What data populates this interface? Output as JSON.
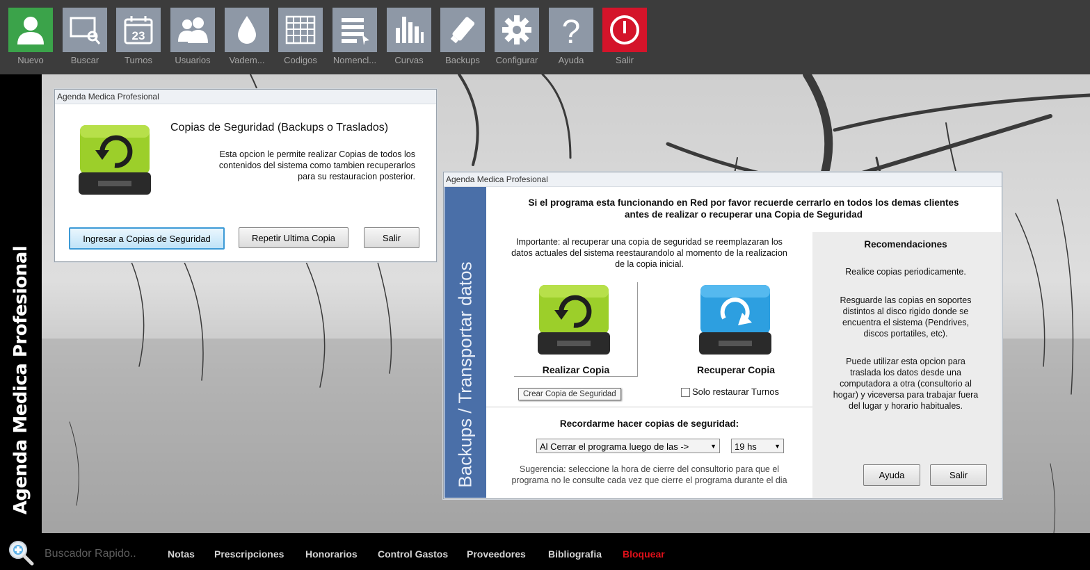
{
  "toolbar": {
    "buttons": [
      {
        "label": "Nuevo",
        "icon": "user-icon",
        "color": "#3ba34a"
      },
      {
        "label": "Buscar",
        "icon": "search-screen-icon"
      },
      {
        "label": "Turnos",
        "icon": "calendar-icon",
        "day": "23"
      },
      {
        "label": "Usuarios",
        "icon": "users-icon"
      },
      {
        "label": "Vadem...",
        "icon": "drop-icon"
      },
      {
        "label": "Codigos",
        "icon": "grid-icon"
      },
      {
        "label": "Nomencl...",
        "icon": "list-icon"
      },
      {
        "label": "Curvas",
        "icon": "bar-chart-icon"
      },
      {
        "label": "Backups",
        "icon": "usb-drive-icon"
      },
      {
        "label": "Configurar",
        "icon": "gear-icon"
      },
      {
        "label": "Ayuda",
        "icon": "question-icon"
      },
      {
        "label": "Salir",
        "icon": "power-icon",
        "color": "#d4142a"
      }
    ]
  },
  "sidebar": {
    "title": "Agenda Medica Profesional"
  },
  "dialog1": {
    "title": "Agenda Medica Profesional",
    "heading": "Copias de Seguridad (Backups o Traslados)",
    "desc_lines": [
      "Esta opcion le permite realizar Copias de todos los",
      "contenidos del sistema como tambien recuperarlos",
      "para su restauracion posterior."
    ],
    "btn_enter": "Ingresar a Copias de Seguridad",
    "btn_repeat": "Repetir Ultima Copia",
    "btn_exit": "Salir"
  },
  "dialog2": {
    "title": "Agenda Medica Profesional",
    "side_banner": "Backups / Transportar datos",
    "warning_lines": [
      "Si el programa esta funcionando en Red por favor recuerde cerrarlo en todos los demas clientes",
      "antes de realizar o recuperar una Copia de Seguridad"
    ],
    "important_lines": [
      "Importante: al recuperar una copia de seguridad se reemplazaran los",
      "datos actuales del sistema reestaurandolo al momento de la realizacion",
      "de la copia inicial."
    ],
    "make_copy": "Realizar Copia",
    "tooltip": "Crear Copia de Seguridad",
    "restore_copy": "Recuperar Copia",
    "only_turns": "Solo restaurar Turnos",
    "reminder_label": "Recordarme hacer copias de seguridad:",
    "reminder_select": "Al Cerrar el programa luego de las ->",
    "hour_select": "19 hs",
    "suggestion_lines": [
      "Sugerencia: seleccione la hora de cierre del consultorio para que el",
      "programa no le consulte cada vez que cierre el programa durante el dia"
    ],
    "reco_title": "Recomendaciones",
    "reco_1": "Realice copias periodicamente.",
    "reco_2_lines": [
      "Resguarde las copias en soportes",
      "distintos al disco rigido donde se",
      "encuentra el sistema (Pendrives,",
      "discos portatiles, etc)."
    ],
    "reco_3_lines": [
      "Puede utilizar esta opcion para",
      "traslada los datos desde una",
      "computadora a otra (consultorio al",
      "hogar) y viceversa para trabajar fuera",
      "del lugar y horario habituales."
    ],
    "btn_help": "Ayuda",
    "btn_exit": "Salir"
  },
  "bottombar": {
    "search_placeholder": "Buscador Rapido..",
    "links": [
      "Notas",
      "Prescripciones",
      "Honorarios",
      "Control Gastos",
      "Proveedores",
      "Bibliografia"
    ],
    "lock": "Bloquear",
    "lock_color": "#e0101a"
  }
}
